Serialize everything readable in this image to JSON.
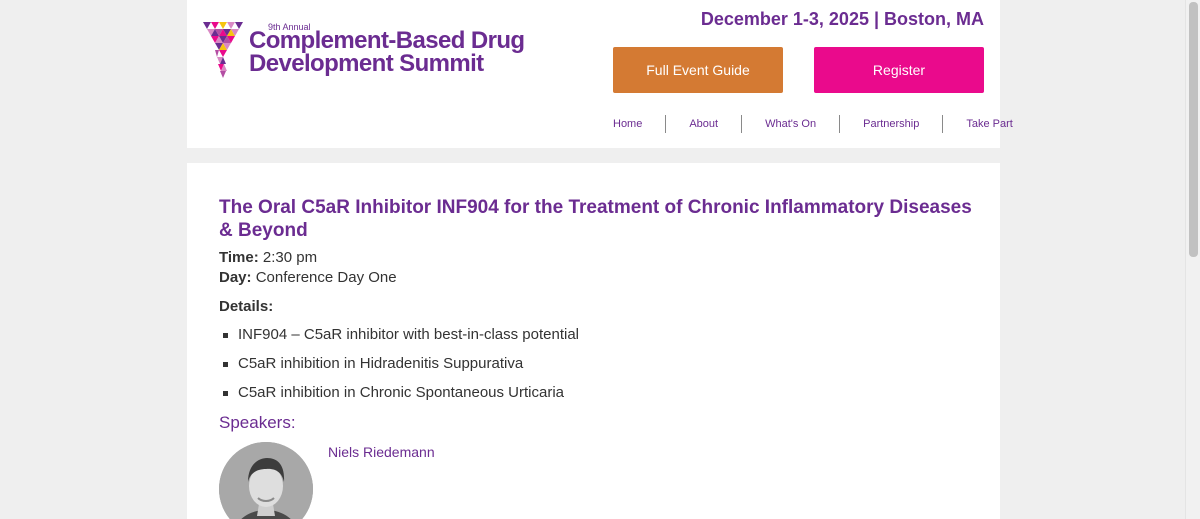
{
  "header": {
    "logo": {
      "annual": "9th Annual",
      "line1": "Complement-Based Drug",
      "line2": "Development Summit"
    },
    "event_date": "December 1-3, 2025 | Boston, MA",
    "buttons": {
      "full_event_guide": "Full Event Guide",
      "register": "Register"
    },
    "nav": [
      "Home",
      "About",
      "What's On",
      "Partnership",
      "Take Part"
    ]
  },
  "session": {
    "title": "The Oral C5aR Inhibitor INF904 for the Treatment of Chronic Inflammatory Diseases & Beyond",
    "time_label": "Time:",
    "time": "2:30 pm",
    "day_label": "Day:",
    "day": "Conference Day One",
    "details_label": "Details:",
    "details": [
      "INF904 – C5aR inhibitor with best-in-class potential",
      "C5aR inhibition in Hidradenitis Suppurativa",
      "C5aR inhibition in Chronic Spontaneous Urticaria"
    ],
    "speakers_label": "Speakers:",
    "speakers": [
      {
        "name": "Niels Riedemann"
      }
    ]
  },
  "colors": {
    "brand_purple": "#6b2c91",
    "guide_orange": "#d47a33",
    "register_pink": "#ea0a8c",
    "page_bg": "#efefef"
  },
  "icons": {
    "logo_mark": "triangle-mosaic-icon",
    "bullet": "square-bullet-icon"
  }
}
